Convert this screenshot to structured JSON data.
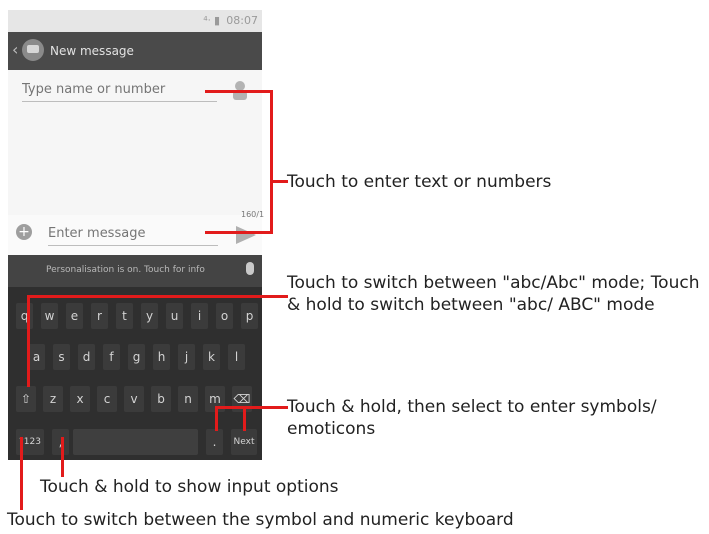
{
  "status": {
    "icons": "⁴ᐧ ▮",
    "time": "08:07"
  },
  "app": {
    "title": "New message"
  },
  "to_field": {
    "placeholder": "Type name or number"
  },
  "compose": {
    "placeholder": "Enter message",
    "counter": "160/1"
  },
  "keyboard": {
    "hint": "Personalisation is on. Touch for info",
    "row1": [
      "q",
      "w",
      "e",
      "r",
      "t",
      "y",
      "u",
      "i",
      "o",
      "p"
    ],
    "row2": [
      "a",
      "s",
      "d",
      "f",
      "g",
      "h",
      "j",
      "k",
      "l"
    ],
    "row3": [
      "⇧",
      "z",
      "x",
      "c",
      "v",
      "b",
      "n",
      "m",
      "⌫"
    ],
    "row4": {
      "symbols": "?123",
      "comma": ",",
      "period": ".",
      "next": "Next"
    }
  },
  "callouts": {
    "enter_text": "Touch to enter text or numbers",
    "switch_case": "Touch to switch  between \"abc/Abc\" mode; Touch & hold to switch between \"abc/ ABC\" mode",
    "symbols": "Touch & hold, then select to enter symbols/ emoticons",
    "input_options": "Touch & hold to show input options",
    "numeric": "Touch to switch between the symbol and numeric keyboard"
  },
  "colors": {
    "callout_line": "#e21b1b"
  }
}
